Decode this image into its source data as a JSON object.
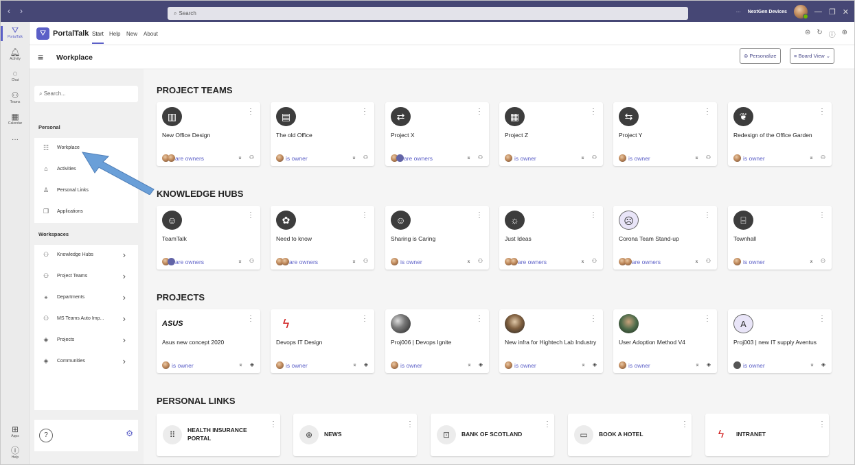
{
  "titlebar": {
    "search_placeholder": "Search",
    "more": "···",
    "org": "NextGen Devices",
    "back": "‹",
    "forward": "›",
    "minimize": "—",
    "maximize": "❐",
    "close": "✕"
  },
  "rail": [
    {
      "label": "PortalTalk",
      "icon": "portaltalk-icon"
    },
    {
      "label": "Activity",
      "icon": "bell-icon"
    },
    {
      "label": "Chat",
      "icon": "chat-icon"
    },
    {
      "label": "Teams",
      "icon": "teams-icon"
    },
    {
      "label": "Calendar",
      "icon": "calendar-icon"
    },
    {
      "label": "···",
      "icon": "more-icon"
    },
    {
      "label": "Apps",
      "icon": "apps-icon"
    },
    {
      "label": "Help",
      "icon": "help-icon"
    }
  ],
  "app": {
    "name": "PortalTalk",
    "tabs": [
      "Start",
      "Help",
      "New",
      "About"
    ],
    "active_tab": "Start"
  },
  "workplace": {
    "title": "Workplace",
    "personalize": "Personalize",
    "board_view": "Board View"
  },
  "sidebar": {
    "search_placeholder": "Search...",
    "personal_heading": "Personal",
    "personal": [
      "Workplace",
      "Activities",
      "Personal Links",
      "Applications"
    ],
    "workspaces_heading": "Workspaces",
    "workspaces": [
      "Knowledge Hubs",
      "Project Teams",
      "Departments",
      "MS Teams Auto Imp...",
      "Projects",
      "Communities"
    ],
    "help": "?"
  },
  "sections": {
    "project_teams": {
      "title": "PROJECT TEAMS",
      "cards": [
        {
          "name": "New Office Design",
          "owner": "are owners"
        },
        {
          "name": "The old Office",
          "owner": "is owner"
        },
        {
          "name": "Project X",
          "owner": "are owners"
        },
        {
          "name": "Project Z",
          "owner": "is owner"
        },
        {
          "name": "Project Y",
          "owner": "is owner"
        },
        {
          "name": "Redesign of the Office Garden",
          "owner": "is owner"
        }
      ]
    },
    "knowledge_hubs": {
      "title": "KNOWLEDGE HUBS",
      "cards": [
        {
          "name": "TeamTalk",
          "owner": "are owners"
        },
        {
          "name": "Need to know",
          "owner": "are owners"
        },
        {
          "name": "Sharing is Caring",
          "owner": "is owner"
        },
        {
          "name": "Just Ideas",
          "owner": "are owners"
        },
        {
          "name": "Corona Team Stand-up",
          "owner": "are owners"
        },
        {
          "name": "Townhall",
          "owner": "is owner"
        }
      ]
    },
    "projects": {
      "title": "PROJECTS",
      "cards": [
        {
          "name": "Asus new concept 2020",
          "owner": "is owner",
          "logo": "ASUS"
        },
        {
          "name": "Devops IT Design",
          "owner": "is owner"
        },
        {
          "name": "Proj006 | Devops Ignite",
          "owner": "is owner"
        },
        {
          "name": "New infra for Hightech Lab Industry",
          "owner": "is owner"
        },
        {
          "name": "User Adoption Method V4",
          "owner": "is owner"
        },
        {
          "name": "Proj003 | new IT supply Aventus",
          "owner": "is owner",
          "logo": "A"
        }
      ]
    },
    "personal_links": {
      "title": "PERSONAL LINKS",
      "links": [
        "HEALTH INSURANCE PORTAL",
        "NEWS",
        "BANK OF SCOTLAND",
        "BOOK A HOTEL",
        "INTRANET"
      ]
    }
  },
  "colors": {
    "titlebar": "#464775",
    "accent": "#5b5fc7",
    "arrow": "#6a9fd8"
  }
}
